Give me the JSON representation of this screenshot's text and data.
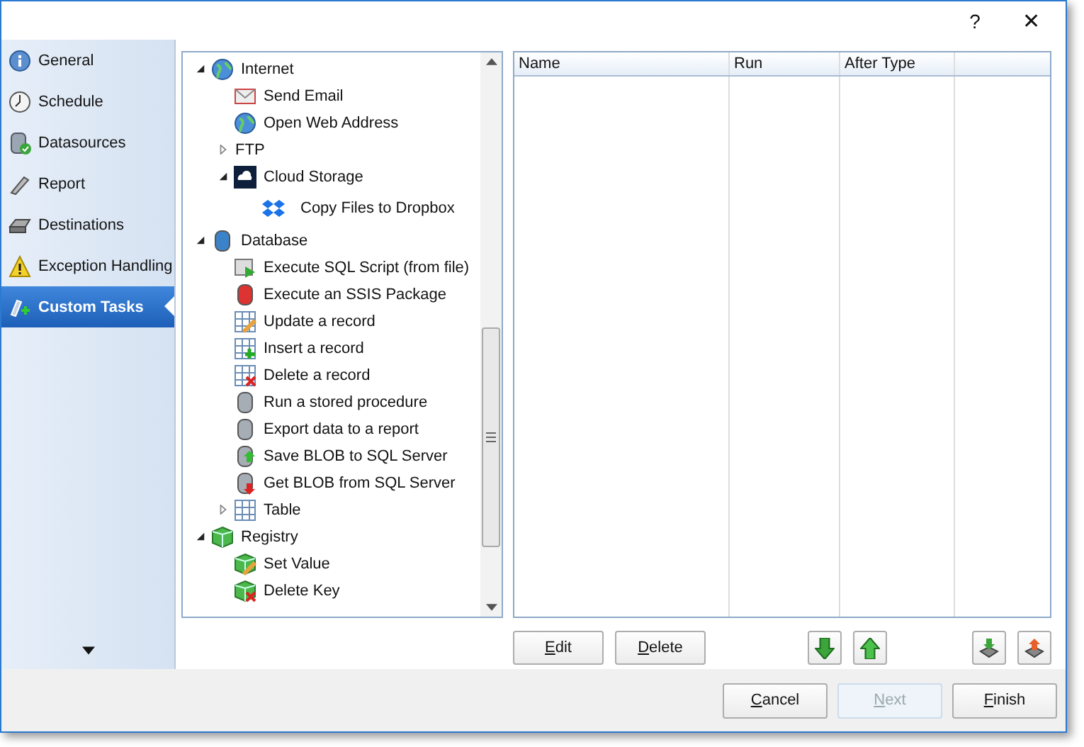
{
  "title_bar": {
    "help": "?",
    "close": "✕"
  },
  "sidebar": {
    "items": [
      {
        "label": "General",
        "selected": false
      },
      {
        "label": "Schedule",
        "selected": false
      },
      {
        "label": "Datasources",
        "selected": false
      },
      {
        "label": "Report",
        "selected": false
      },
      {
        "label": "Destinations",
        "selected": false
      },
      {
        "label": "Exception Handling",
        "selected": false
      },
      {
        "label": "Custom Tasks",
        "selected": true
      }
    ]
  },
  "tree": [
    {
      "label": "Internet",
      "expanded": true,
      "children": [
        {
          "label": "Send Email"
        },
        {
          "label": "Open Web Address"
        },
        {
          "label": "FTP",
          "expanded": false
        },
        {
          "label": "Cloud Storage",
          "expanded": true,
          "children": [
            {
              "label": "Copy Files to Dropbox"
            }
          ]
        }
      ]
    },
    {
      "label": "Database",
      "expanded": true,
      "children": [
        {
          "label": "Execute SQL Script (from file)"
        },
        {
          "label": "Execute an SSIS Package"
        },
        {
          "label": "Update a record"
        },
        {
          "label": "Insert a record"
        },
        {
          "label": "Delete a record"
        },
        {
          "label": "Run a stored procedure"
        },
        {
          "label": "Export data to a report"
        },
        {
          "label": "Save BLOB to SQL Server"
        },
        {
          "label": "Get BLOB from SQL Server"
        },
        {
          "label": "Table",
          "expanded": false
        }
      ]
    },
    {
      "label": "Registry",
      "expanded": true,
      "children": [
        {
          "label": "Set Value"
        },
        {
          "label": "Delete Key"
        }
      ]
    }
  ],
  "table": {
    "columns": [
      "Name",
      "Run",
      "After Type"
    ]
  },
  "list_buttons": [
    {
      "key": "E",
      "rest": "dit"
    },
    {
      "key": "D",
      "rest": "elete"
    }
  ],
  "footer_buttons": [
    {
      "key": "C",
      "rest": "ancel",
      "disabled": false
    },
    {
      "key": "N",
      "rest": "ext",
      "disabled": true
    },
    {
      "key": "F",
      "rest": "inish",
      "disabled": false
    }
  ]
}
